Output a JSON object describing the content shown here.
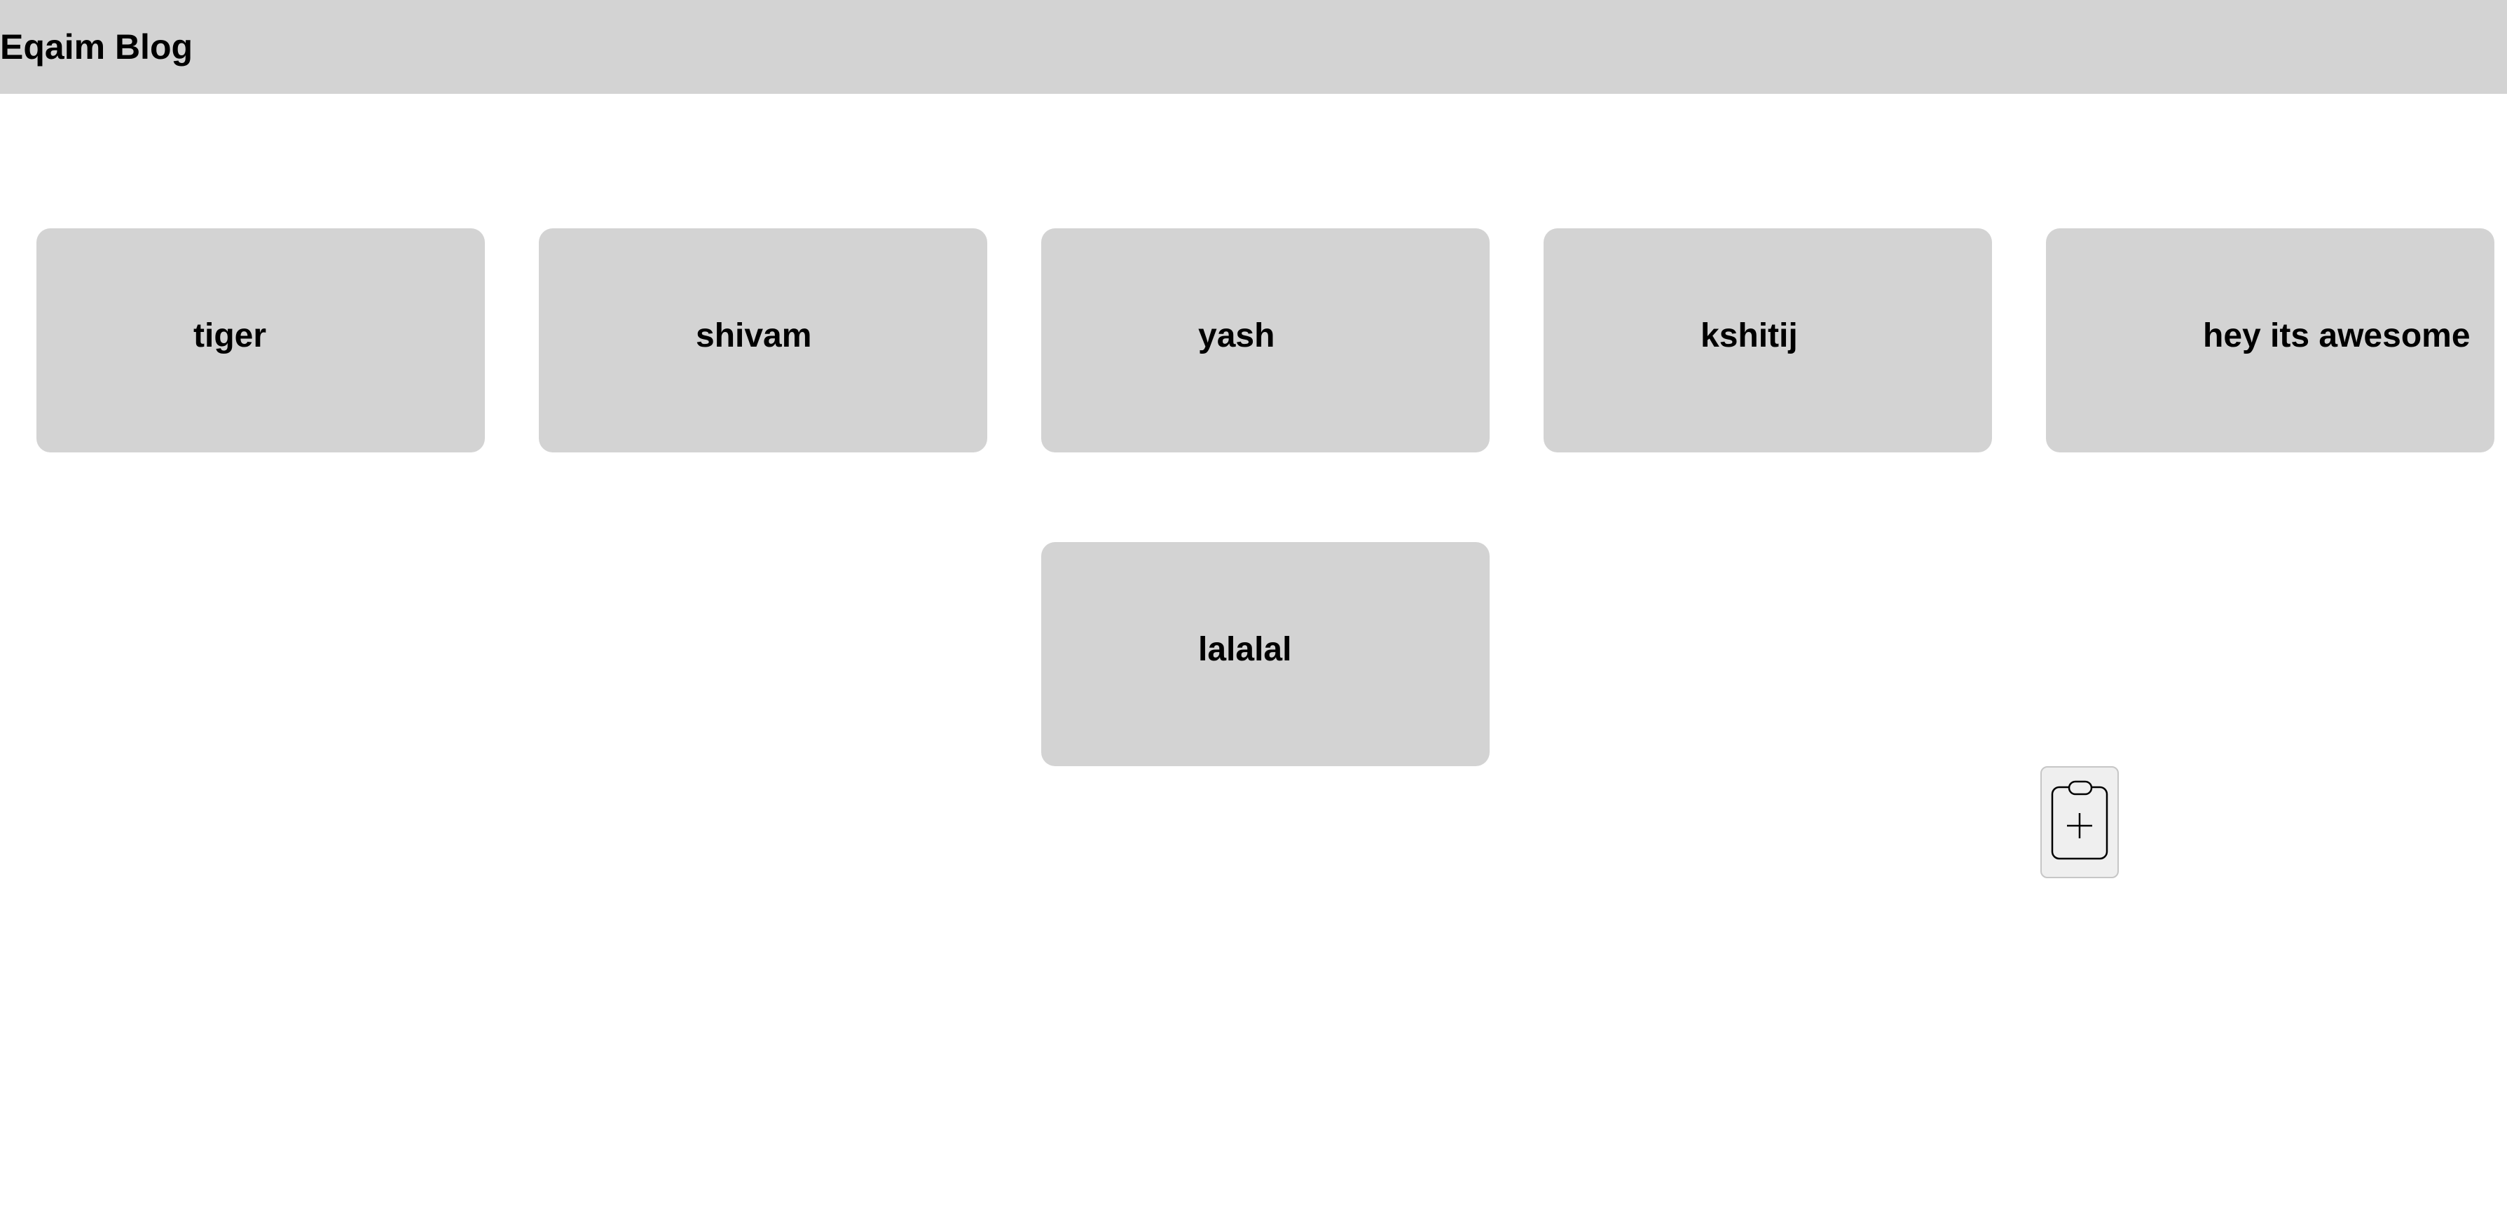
{
  "header": {
    "title": "Eqaim Blog"
  },
  "posts": [
    {
      "title": "tiger"
    },
    {
      "title": "shivam"
    },
    {
      "title": "yash"
    },
    {
      "title": "kshitij"
    },
    {
      "title": "hey its awesome"
    },
    {
      "title": "lalalal"
    }
  ],
  "actions": {
    "add_post_icon": "clipboard-plus-icon"
  },
  "colors": {
    "header_bg": "#d3d3d3",
    "card_bg": "#d3d3d3",
    "button_bg": "#efefef",
    "text": "#000000"
  }
}
